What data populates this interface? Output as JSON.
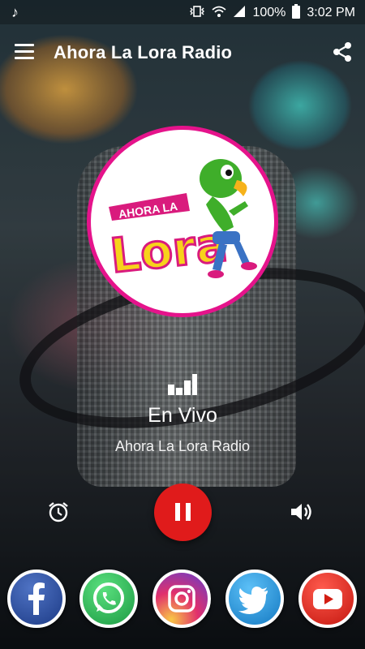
{
  "status_bar": {
    "battery_percent": "100%",
    "time": "3:02 PM"
  },
  "app_bar": {
    "title": "Ahora La Lora Radio"
  },
  "logo": {
    "text_top": "AHORA LA",
    "text_main": "Lora"
  },
  "now_playing": {
    "status": "En Vivo",
    "station": "Ahora La Lora Radio"
  },
  "controls": {
    "state": "playing"
  },
  "social": {
    "items": [
      "facebook",
      "whatsapp",
      "instagram",
      "twitter",
      "youtube"
    ]
  },
  "colors": {
    "play_button": "#e01b1b",
    "logo_ring": "#e5138b",
    "facebook": "#3b5998",
    "whatsapp": "#25d366",
    "instagram": "#c1358a",
    "twitter": "#1da1f2",
    "youtube": "#e52d27"
  }
}
